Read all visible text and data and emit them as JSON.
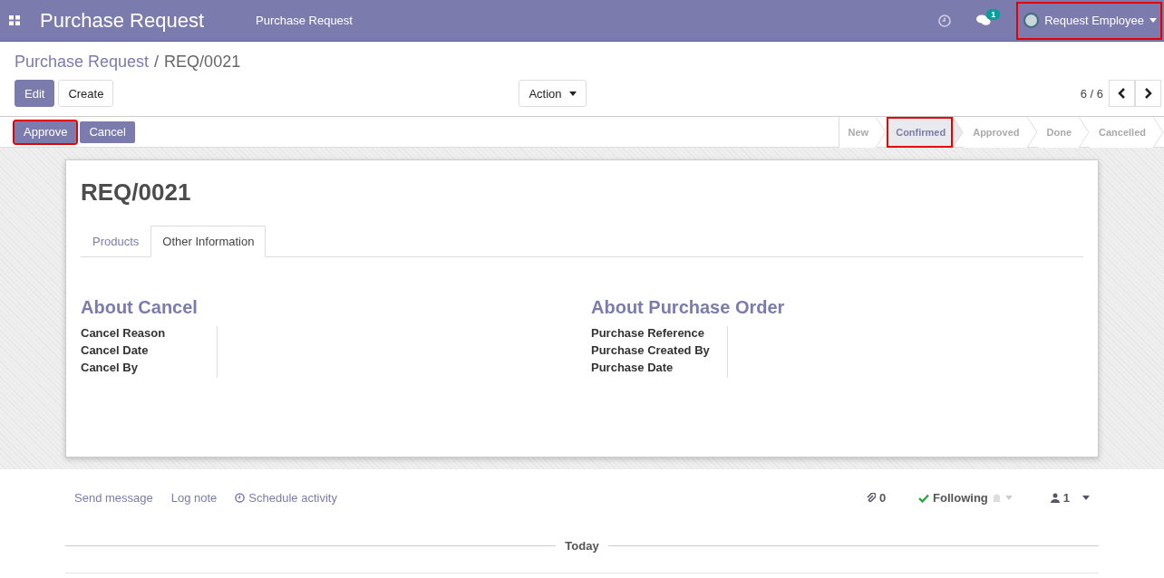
{
  "navbar": {
    "app_title": "Purchase Request",
    "menu": [
      "Purchase Request"
    ],
    "message_count": "1",
    "user": {
      "name": "Request Employee",
      "highlighted": true
    }
  },
  "breadcrumb": {
    "parent": "Purchase Request",
    "separator": "/",
    "current": "REQ/0021"
  },
  "buttons": {
    "main": [
      {
        "label": "Edit",
        "kind": "primary"
      },
      {
        "label": "Create",
        "kind": "secondary"
      }
    ],
    "action": "Action",
    "pager": "6 / 6"
  },
  "header_buttons": [
    {
      "label": "Approve",
      "highlighted": true
    },
    {
      "label": "Cancel",
      "highlighted": false
    }
  ],
  "stages": [
    {
      "label": "New",
      "selected": false,
      "highlighted": false
    },
    {
      "label": "Confirmed",
      "selected": true,
      "highlighted": true
    },
    {
      "label": "Approved",
      "selected": false,
      "highlighted": false
    },
    {
      "label": "Done",
      "selected": false,
      "highlighted": false
    },
    {
      "label": "Cancelled",
      "selected": false,
      "highlighted": false
    }
  ],
  "sheet": {
    "title": "REQ/0021",
    "tabs": [
      {
        "label": "Products",
        "selected": false
      },
      {
        "label": "Other Information",
        "selected": true
      }
    ],
    "groups": [
      {
        "title": "About Cancel",
        "fields": [
          "Cancel Reason",
          "Cancel Date",
          "Cancel By"
        ]
      },
      {
        "title": "About Purchase Order",
        "fields": [
          "Purchase Reference",
          "Purchase Created By",
          "Purchase Date"
        ]
      }
    ]
  },
  "chatter": {
    "actions": [
      {
        "label": "Send message",
        "kind": "text"
      },
      {
        "label": "Log note",
        "kind": "text"
      },
      {
        "label": "Schedule activity",
        "kind": "clock"
      }
    ],
    "attachments": "0",
    "following": "Following",
    "followers": "1",
    "divider": "Today"
  }
}
